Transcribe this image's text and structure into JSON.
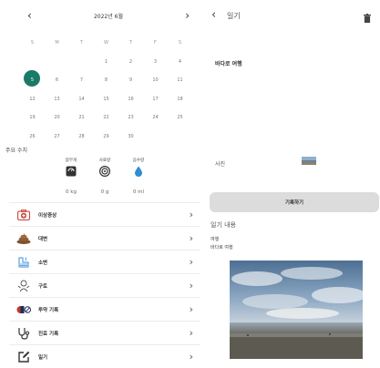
{
  "calendar": {
    "prev_label": "‹",
    "next_label": "›",
    "month_title": "2022년 6월",
    "weekdays": [
      "S",
      "M",
      "T",
      "W",
      "T",
      "F",
      "S"
    ],
    "weeks": [
      [
        "",
        "",
        "",
        "1",
        "2",
        "3",
        "4"
      ],
      [
        "5",
        "6",
        "7",
        "8",
        "9",
        "10",
        "11"
      ],
      [
        "12",
        "13",
        "14",
        "15",
        "16",
        "17",
        "18"
      ],
      [
        "19",
        "20",
        "21",
        "22",
        "23",
        "24",
        "25"
      ],
      [
        "26",
        "27",
        "28",
        "29",
        "30",
        "",
        ""
      ]
    ],
    "selected_day": "5",
    "accent_color": "#1a7a68"
  },
  "summary": {
    "title": "주요 수치",
    "stats": [
      {
        "label": "몸무게",
        "value": "0 kg",
        "icon": "scale-icon"
      },
      {
        "label": "사료량",
        "value": "0 g",
        "icon": "food-bowl-icon"
      },
      {
        "label": "음수량",
        "value": "0 ml",
        "icon": "water-drop-icon"
      }
    ]
  },
  "menu": {
    "items": [
      {
        "label": "이상증상",
        "icon": "medical-kit-icon"
      },
      {
        "label": "대변",
        "icon": "poop-icon"
      },
      {
        "label": "소변",
        "icon": "urine-icon"
      },
      {
        "label": "구토",
        "icon": "vomit-icon"
      },
      {
        "label": "투약 기록",
        "icon": "pill-icon"
      },
      {
        "label": "진료 기록",
        "icon": "stethoscope-icon"
      },
      {
        "label": "일기",
        "icon": "diary-edit-icon"
      }
    ],
    "chevron": "›"
  },
  "diary": {
    "back_label": "‹",
    "header_title": "일기",
    "title_value": "바다로 여행",
    "photo_label": "사진",
    "record_button": "기록하기",
    "content_heading": "일기 내용",
    "content_line1": "여행",
    "content_line2": "바다로 여행"
  }
}
